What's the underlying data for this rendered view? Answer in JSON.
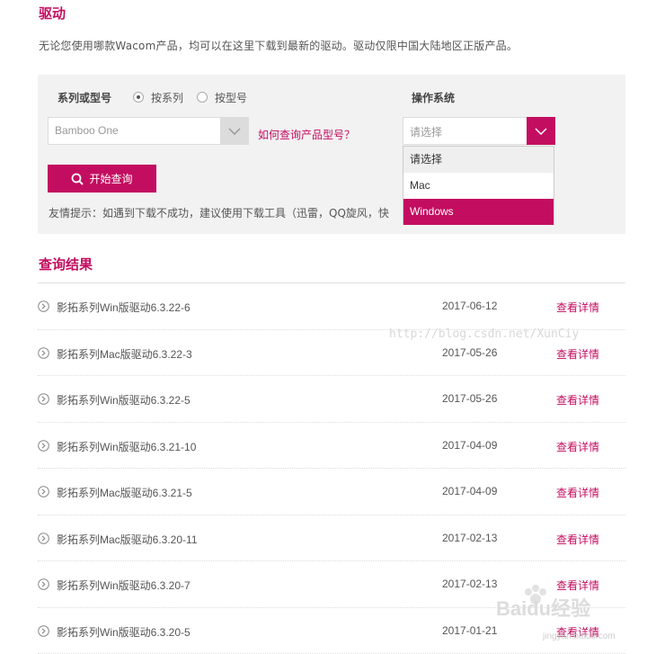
{
  "page": {
    "title": "驱动",
    "intro": "无论您使用哪款Wacom产品，均可以在这里下载到最新的驱动。驱动仅限中国大陆地区正版产品。"
  },
  "search": {
    "series_label": "系列或型号",
    "radio_series": "按系列",
    "radio_model": "按型号",
    "radio_selected": "按系列",
    "product_value": "Bamboo One",
    "help_link": "如何查询产品型号？",
    "os_label": "操作系统",
    "os_placeholder": "请选择",
    "os_options": [
      "请选择",
      "Mac",
      "Windows"
    ],
    "os_highlighted": "Windows",
    "search_button": "开始查询",
    "tip": "友情提示：如遇到下载不成功，建议使用下载工具（迅雷，QQ旋风，快"
  },
  "results": {
    "title": "查询结果",
    "detail_label": "查看详情",
    "rows": [
      {
        "name": "影拓系列Win版驱动6.3.22-6",
        "date": "2017-06-12"
      },
      {
        "name": "影拓系列Mac版驱动6.3.22-3",
        "date": "2017-05-26"
      },
      {
        "name": "影拓系列Win版驱动6.3.22-5",
        "date": "2017-05-26"
      },
      {
        "name": "影拓系列Win版驱动6.3.21-10",
        "date": "2017-04-09"
      },
      {
        "name": "影拓系列Mac版驱动6.3.21-5",
        "date": "2017-04-09"
      },
      {
        "name": "影拓系列Mac版驱动6.3.20-11",
        "date": "2017-02-13"
      },
      {
        "name": "影拓系列Win版驱动6.3.20-7",
        "date": "2017-02-13"
      },
      {
        "name": "影拓系列Win版驱动6.3.20-5",
        "date": "2017-01-21"
      }
    ]
  },
  "watermarks": {
    "blog_url": "http://blog.csdn.net/XunCiy",
    "baidu_logo": "Baidu经验",
    "baidu_sub": "jingyan.baidu.com"
  },
  "colors": {
    "accent": "#c30d60",
    "panel_bg": "#f2f2f2"
  },
  "icons": {
    "search_button": "search-icon",
    "row": "circle-chevron-right-icon",
    "select": "chevron-down-icon"
  }
}
